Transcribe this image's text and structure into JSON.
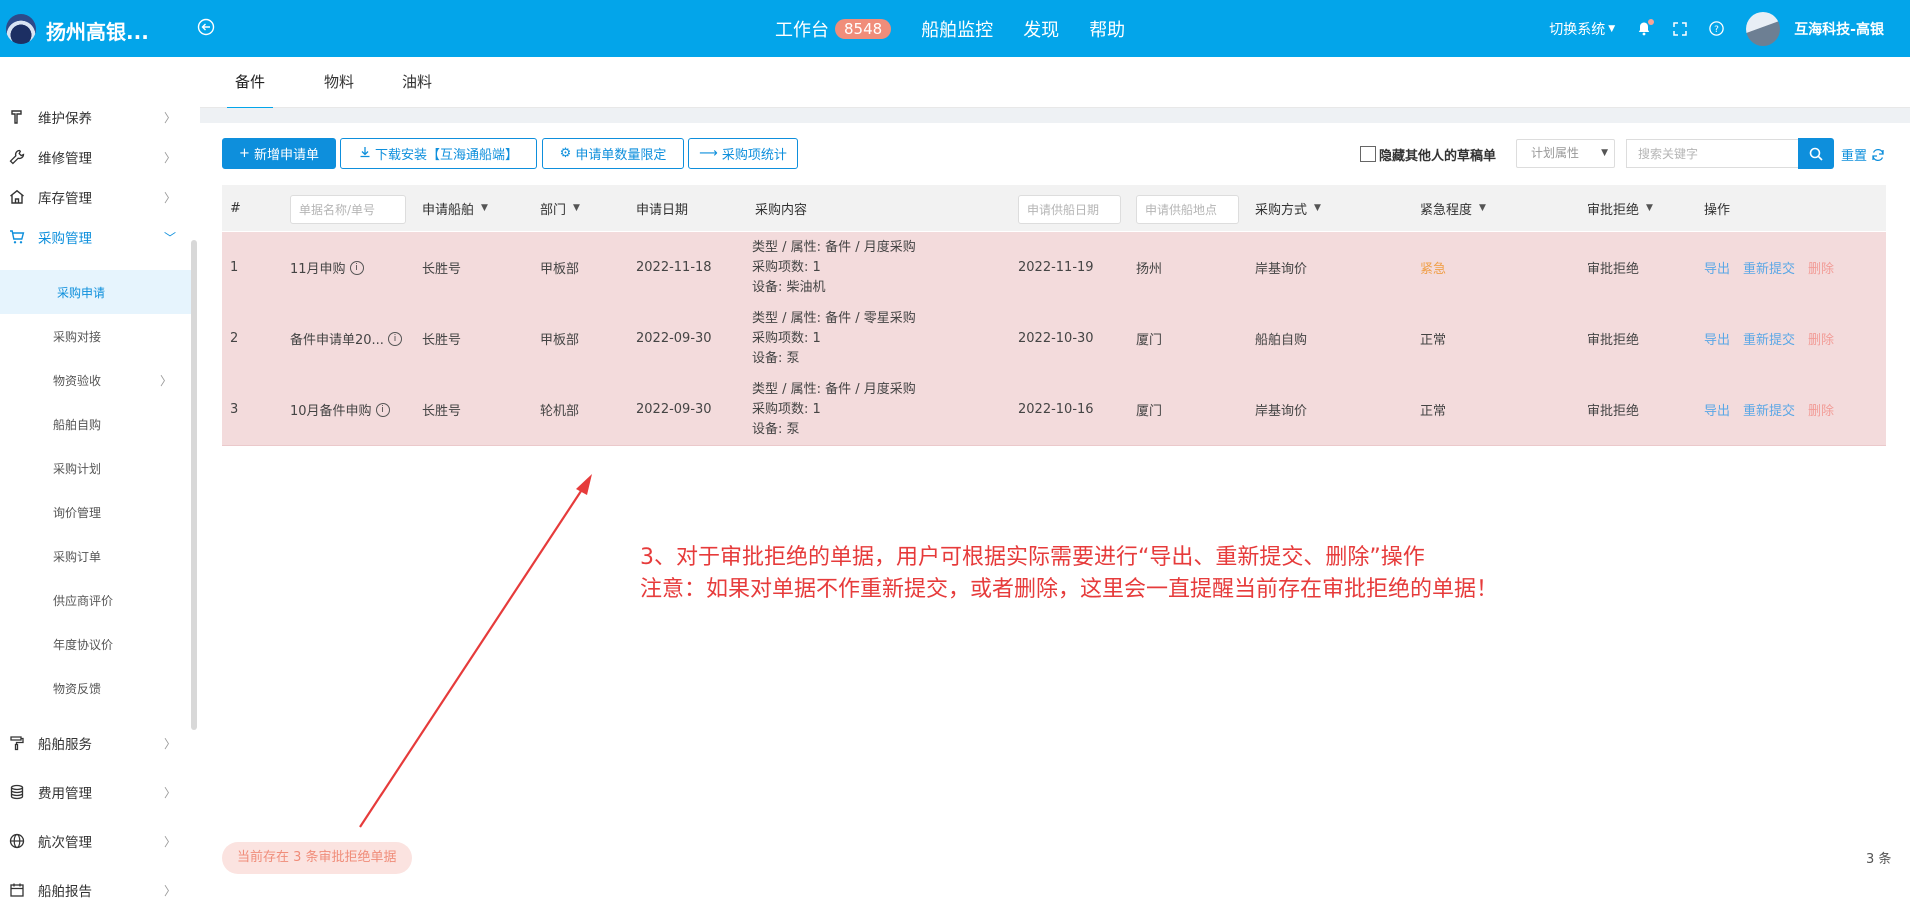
{
  "header": {
    "app_title": "扬州高银...",
    "nav": {
      "workbench": "工作台",
      "workbench_badge": "8548",
      "ship_monitor": "船舶监控",
      "discover": "发现",
      "help": "帮助"
    },
    "switch_system": "切换系统",
    "user_name": "互海科技-高银",
    "brand_color": "#03a5ea"
  },
  "sidebar": {
    "menu": [
      {
        "label": "维护保养",
        "icon": "hammer-icon"
      },
      {
        "label": "维修管理",
        "icon": "wrench-icon"
      },
      {
        "label": "库存管理",
        "icon": "warehouse-icon"
      },
      {
        "label": "采购管理",
        "icon": "cart-icon"
      }
    ],
    "sub_items": [
      {
        "label": "采购申请"
      },
      {
        "label": "采购对接"
      },
      {
        "label": "物资验收"
      },
      {
        "label": "船舶自购"
      },
      {
        "label": "采购计划"
      },
      {
        "label": "询价管理"
      },
      {
        "label": "采购订单"
      },
      {
        "label": "供应商评价"
      },
      {
        "label": "年度协议价"
      },
      {
        "label": "物资反馈"
      }
    ],
    "menu_bottom": [
      {
        "label": "船舶服务",
        "icon": "paint-roller-icon"
      },
      {
        "label": "费用管理",
        "icon": "coins-icon"
      },
      {
        "label": "航次管理",
        "icon": "globe-icon"
      },
      {
        "label": "船舶报告",
        "icon": "calendar-icon"
      }
    ]
  },
  "tabs": [
    "备件",
    "物料",
    "油料"
  ],
  "toolbar": {
    "add_btn": "新增申请单",
    "download_btn": "下载安装【互海通船端】",
    "limit_btn": "申请单数量限定",
    "stats_btn": "采购项统计",
    "hide_drafts": "隐藏其他人的草稿单",
    "plan_attr_placeholder": "计划属性",
    "search_placeholder": "搜索关键字",
    "reset": "重置"
  },
  "table": {
    "headers": {
      "index": "#",
      "name_placeholder": "单据名称/单号",
      "ship": "申请船舶",
      "dept": "部门",
      "apply_date": "申请日期",
      "content": "采购内容",
      "supply_date_placeholder": "申请供船日期",
      "supply_place_placeholder": "申请供船地点",
      "method": "采购方式",
      "urgency": "紧急程度",
      "status": "审批拒绝",
      "ops": "操作"
    },
    "rows": [
      {
        "index": "1",
        "name": "11月申购",
        "ship": "长胜号",
        "dept": "甲板部",
        "apply_date": "2022-11-18",
        "content_type": "类型 / 属性:  备件 / 月度采购",
        "content_count": "采购项数:  1",
        "content_equip": "设备:   柴油机",
        "supply_date": "2022-11-19",
        "supply_place": "扬州",
        "method": "岸基询价",
        "urgency": "紧急",
        "status": "审批拒绝",
        "op_export": "导出",
        "op_resubmit": "重新提交",
        "op_delete": "删除"
      },
      {
        "index": "2",
        "name": "备件申请单20...",
        "ship": "长胜号",
        "dept": "甲板部",
        "apply_date": "2022-09-30",
        "content_type": "类型 / 属性:  备件 / 零星采购",
        "content_count": "采购项数:  1",
        "content_equip": "设备:   泵",
        "supply_date": "2022-10-30",
        "supply_place": "厦门",
        "method": "船舶自购",
        "urgency": "正常",
        "status": "审批拒绝",
        "op_export": "导出",
        "op_resubmit": "重新提交",
        "op_delete": "删除"
      },
      {
        "index": "3",
        "name": "10月备件申购",
        "ship": "长胜号",
        "dept": "轮机部",
        "apply_date": "2022-09-30",
        "content_type": "类型 / 属性:  备件 / 月度采购",
        "content_count": "采购项数:  1",
        "content_equip": "设备:   泵",
        "supply_date": "2022-10-16",
        "supply_place": "厦门",
        "method": "岸基询价",
        "urgency": "正常",
        "status": "审批拒绝",
        "op_export": "导出",
        "op_resubmit": "重新提交",
        "op_delete": "删除"
      }
    ]
  },
  "annotation": {
    "line1": "3、对于审批拒绝的单据，用户可根据实际需要进行“导出、重新提交、删除”操作",
    "line2": "注意：如果对单据不作重新提交，或者删除，这里会一直提醒当前存在审批拒绝的单据！"
  },
  "footer": {
    "rejected_notice": "当前存在 3 条审批拒绝单据",
    "total": "3 条"
  }
}
